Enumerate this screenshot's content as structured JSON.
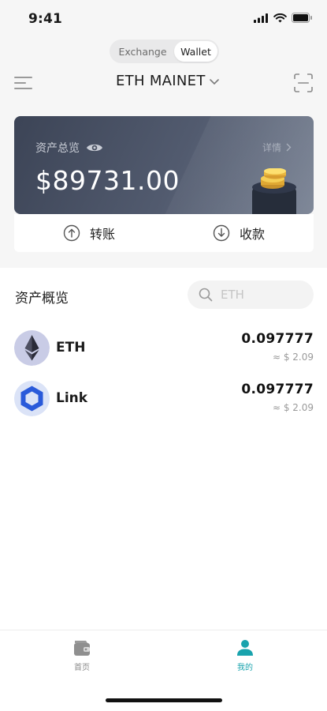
{
  "status_bar": {
    "time": "9:41"
  },
  "segment": {
    "items": [
      {
        "label": "Exchange"
      },
      {
        "label": "Wallet"
      }
    ]
  },
  "header": {
    "network": "ETH MAINET"
  },
  "asset_card": {
    "label": "资产总览",
    "detail": "详情",
    "amount": "$89731.00"
  },
  "actions": {
    "transfer": "转账",
    "receive": "收款"
  },
  "overview": {
    "title": "资产概览",
    "search_placeholder": "ETH"
  },
  "tokens": [
    {
      "name": "ETH",
      "amount": "0.097777",
      "fiat": "≈ $ 2.09",
      "icon": "ethereum-icon"
    },
    {
      "name": "Link",
      "amount": "0.097777",
      "fiat": "≈ $ 2.09",
      "icon": "chainlink-icon"
    }
  ],
  "tabbar": {
    "home": "首页",
    "mine": "我的",
    "active": "mine",
    "active_color": "#19a3ad"
  }
}
